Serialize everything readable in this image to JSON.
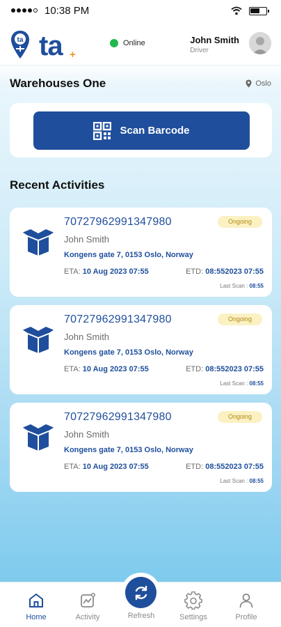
{
  "status_bar": {
    "time": "10:38 PM",
    "battery_level": 0.6,
    "icons": [
      "signal-dots-icon",
      "wifi-icon",
      "battery-icon"
    ]
  },
  "header": {
    "logo_text": "ta",
    "logo_plus": "+",
    "online_label": "Online",
    "online_color": "#21b84b",
    "user_name": "John Smith",
    "user_role": "Driver"
  },
  "warehouse": {
    "title": "Warehouses One",
    "location": "Oslo"
  },
  "scan": {
    "label": "Scan Barcode"
  },
  "recent": {
    "title": "Recent Activities",
    "items": [
      {
        "tracking": "70727962991347980",
        "status": "Ongoing",
        "name": "John Smith",
        "address": "Kongens gate 7, 0153 Oslo, Norway",
        "eta_label": "ETA:",
        "eta": "10 Aug 2023 07:55",
        "etd_label": "ETD:",
        "etd": "08:552023 07:55",
        "last_scan_label": "Last Scan :",
        "last_scan": "08:55"
      },
      {
        "tracking": "70727962991347980",
        "status": "Ongoing",
        "name": "John Smith",
        "address": "Kongens gate 7, 0153 Oslo, Norway",
        "eta_label": "ETA:",
        "eta": "10 Aug 2023 07:55",
        "etd_label": "ETD:",
        "etd": "08:552023 07:55",
        "last_scan_label": "Last Scan :",
        "last_scan": "08:55"
      },
      {
        "tracking": "70727962991347980",
        "status": "Ongoing",
        "name": "John Smith",
        "address": "Kongens gate 7, 0153 Oslo, Norway",
        "eta_label": "ETA:",
        "eta": "10 Aug 2023 07:55",
        "etd_label": "ETD:",
        "etd": "08:552023 07:55",
        "last_scan_label": "Last Scan :",
        "last_scan": "08:55"
      }
    ]
  },
  "nav": {
    "home": "Home",
    "activity": "Activity",
    "refresh": "Refresh",
    "settings": "Settings",
    "profile": "Profile",
    "active": "home"
  },
  "colors": {
    "brand": "#1f4e9c",
    "accent": "#f0932b",
    "badge_bg": "#fbf1c2",
    "badge_text": "#b08a16"
  }
}
